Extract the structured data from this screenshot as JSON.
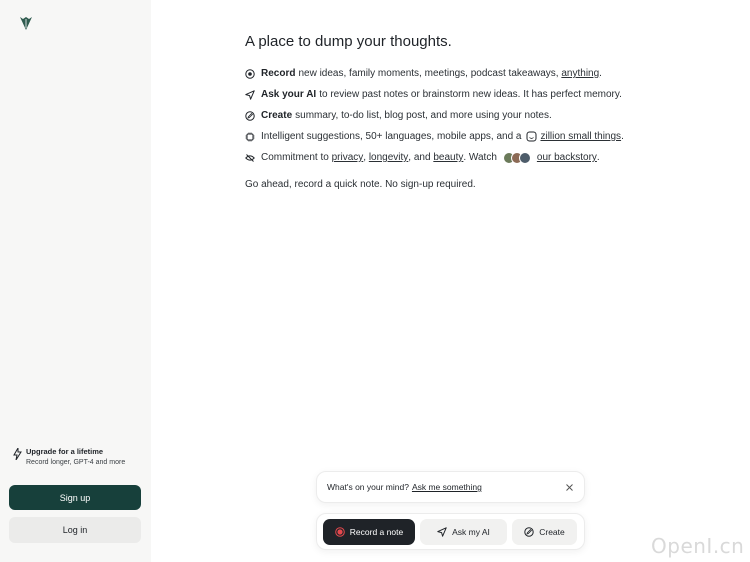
{
  "sidebar": {
    "logo_icon": "leaf-logo-icon",
    "upgrade": {
      "title": "Upgrade for a lifetime",
      "subtitle": "Record longer, GPT-4 and more",
      "icon": "bolt-icon"
    },
    "signup_label": "Sign up",
    "login_label": "Log in"
  },
  "main": {
    "headline": "A place to dump your thoughts.",
    "features": [
      {
        "icon": "record-icon",
        "bold": "Record",
        "text": "new ideas, family moments, meetings, podcast takeaways,",
        "link": "anything",
        "after": "."
      },
      {
        "icon": "send-icon",
        "bold": "Ask your AI",
        "text": "to review past notes or brainstorm new ideas. It has perfect memory."
      },
      {
        "icon": "pencil-circle-icon",
        "bold": "Create",
        "text": "summary, to-do list, blog post, and more using your notes."
      },
      {
        "icon": "chip-icon",
        "text": "Intelligent suggestions, 50+ languages, mobile apps, and a",
        "link": "zillion small things",
        "after": "."
      },
      {
        "icon": "eye-off-icon",
        "text": "Commitment to",
        "link1": "privacy",
        "sep1": ",",
        "link2": "longevity",
        "sep2": ", and",
        "link3": "beauty",
        "sep3": ". Watch",
        "link4": "our backstory",
        "after": "."
      }
    ],
    "note": "Go ahead, record a quick note. No sign-up required."
  },
  "prompt": {
    "text": "What's on your mind?",
    "ask_link": "Ask me something"
  },
  "actions": {
    "record_label": "Record a note",
    "ask_label": "Ask my AI",
    "create_label": "Create"
  },
  "watermark": "OpenI.cn",
  "colors": {
    "primary": "#17403b",
    "record_dot": "#e5484d",
    "dark_button": "#1f2328"
  }
}
